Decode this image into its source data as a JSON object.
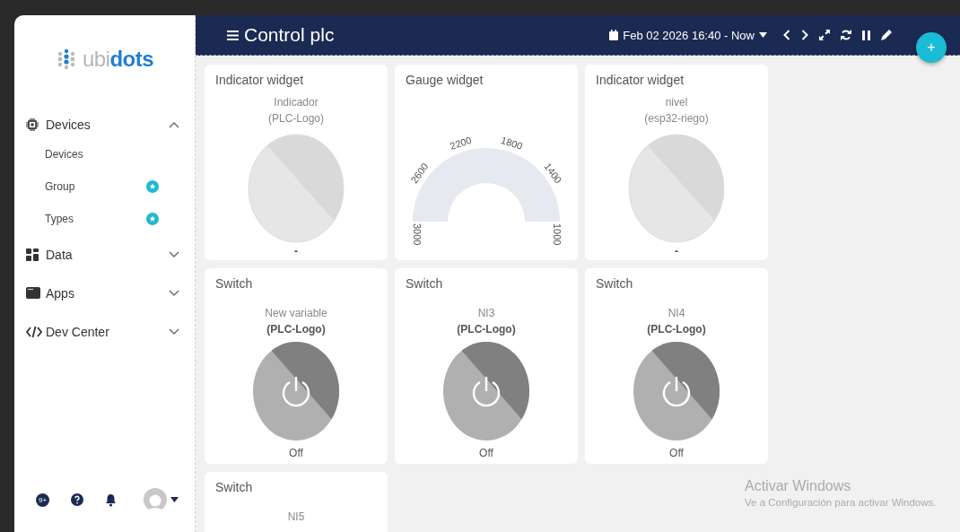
{
  "header": {
    "title": "Control plc",
    "date_range": "Feb 02 2026 16:40 - Now",
    "add_button": "+"
  },
  "sidebar": {
    "logo": {
      "part_1": "ubi",
      "part_2": "dots"
    },
    "items": [
      {
        "label": "Devices",
        "expanded": true,
        "children": [
          {
            "label": "Devices",
            "starred": false
          },
          {
            "label": "Group",
            "starred": true
          },
          {
            "label": "Types",
            "starred": true
          }
        ]
      },
      {
        "label": "Data",
        "expanded": false
      },
      {
        "label": "Apps",
        "expanded": false
      },
      {
        "label": "Dev Center",
        "expanded": false
      }
    ],
    "footer": {
      "notification_count": "9+"
    }
  },
  "widgets": [
    {
      "kind": "indicator",
      "title": "Indicator widget",
      "variable": "Indicador",
      "device": "(PLC-Logo)",
      "value": "-"
    },
    {
      "kind": "gauge",
      "title": "Gauge widget",
      "ticks": [
        "3000",
        "2600",
        "2200",
        "1800",
        "1400",
        "1000"
      ]
    },
    {
      "kind": "indicator",
      "title": "Indicator widget",
      "variable": "nivel",
      "device": "(esp32-riego)",
      "value": "-"
    },
    {
      "kind": "switch",
      "title": "Switch",
      "variable": "New variable",
      "device": "(PLC-Logo)",
      "on": false,
      "status": "Off"
    },
    {
      "kind": "switch",
      "title": "Switch",
      "variable": "NI3",
      "device": "(PLC-Logo)",
      "on": false,
      "status": "Off"
    },
    {
      "kind": "switch",
      "title": "Switch",
      "variable": "NI4",
      "device": "(PLC-Logo)",
      "on": false,
      "status": "Off"
    },
    {
      "kind": "switch",
      "title": "Switch",
      "variable": "NI5"
    }
  ],
  "os_notice": {
    "title": "Activar Windows",
    "text": "Ve a Configuración para activar Windows."
  }
}
